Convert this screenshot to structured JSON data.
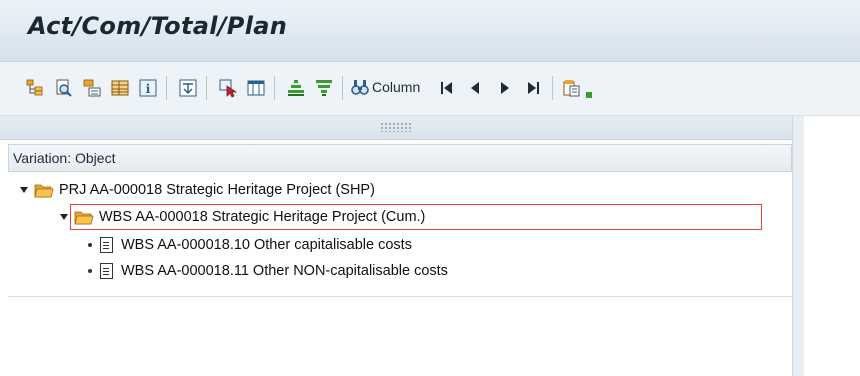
{
  "window": {
    "title": "Act/Com/Total/Plan"
  },
  "toolbar": {
    "icons": [
      "expand-tree-icon",
      "find-icon",
      "structure-icon",
      "layout-icon",
      "info-icon",
      "print-icon",
      "select-icon",
      "grid-icon",
      "sort-ascending-icon",
      "filter-icon",
      "column-search-icon",
      "first-page-icon",
      "previous-page-icon",
      "next-page-icon",
      "last-page-icon",
      "copy-icon"
    ],
    "column_label": "Column"
  },
  "variation": {
    "label": "Variation: Object"
  },
  "tree": {
    "rows": [
      {
        "label": "PRJ AA-000018 Strategic Heritage Project (SHP)",
        "kind": "folder",
        "expanded": true,
        "level": 0
      },
      {
        "label": "WBS AA-000018 Strategic Heritage Project (Cum.)",
        "kind": "folder",
        "expanded": true,
        "level": 1,
        "selected": true
      },
      {
        "label": "WBS AA-000018.10 Other capitalisable costs",
        "kind": "document",
        "level": 2
      },
      {
        "label": "WBS AA-000018.11 Other NON-capitalisable costs",
        "kind": "document",
        "level": 2
      }
    ]
  },
  "colors": {
    "folder": "#f5a623",
    "selection": "#e2463a",
    "title_bg": "#dfe8f1"
  }
}
